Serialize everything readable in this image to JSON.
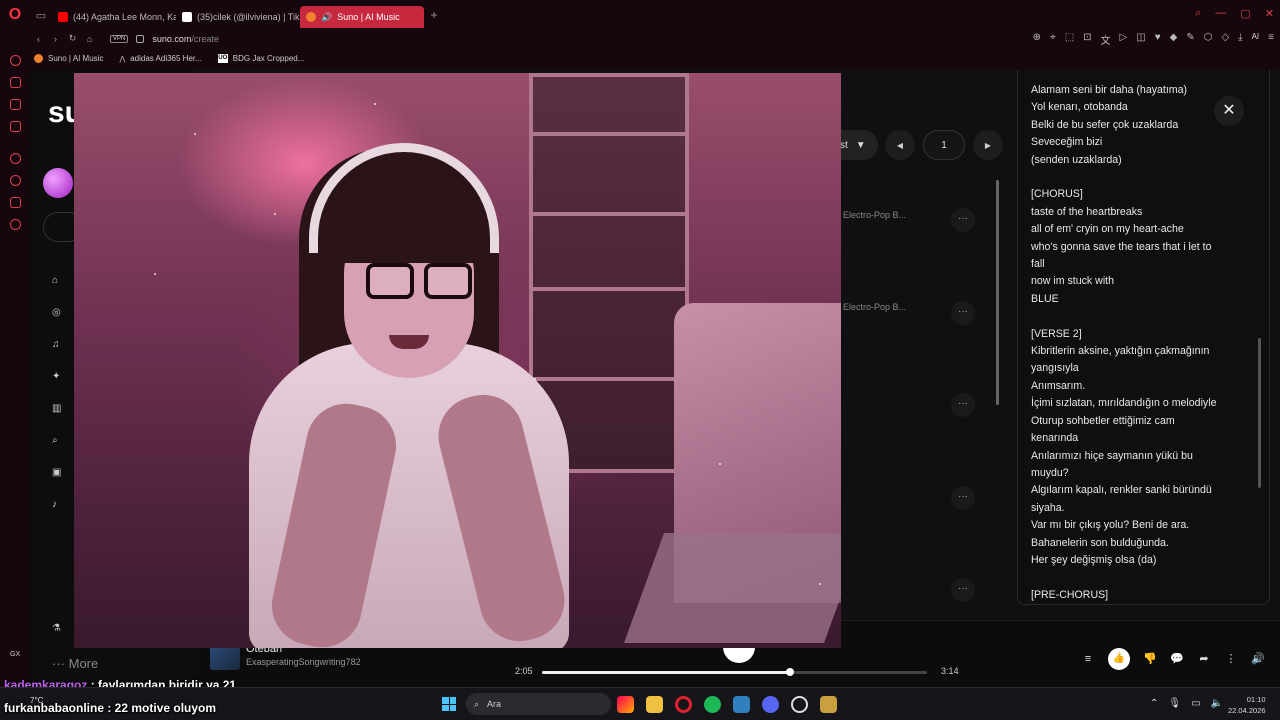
{
  "browser": {
    "tabs": [
      {
        "label": "(44) Agatha Lee Monn, Ka",
        "favicon_color": "#ff0000"
      },
      {
        "label": "(35)cilek (@ilviviena) | Tik",
        "favicon_color": "#ffffff"
      },
      {
        "label": "Suno | AI Music",
        "favicon_color": "#f08030",
        "active": true
      }
    ],
    "vpn_label": "VPN",
    "url_host": "suno.com",
    "url_path": "/create",
    "ai_label": "AI",
    "bookmarks": [
      {
        "label": "Suno | AI Music",
        "icon": "suno-icon"
      },
      {
        "label": "adidas Adi365 Her...",
        "icon": "adidas-icon"
      },
      {
        "label": "BDG Jax Cropped...",
        "icon": "uo-icon"
      }
    ],
    "uo_badge": "UO",
    "gx_label": "GX"
  },
  "suno": {
    "logo_text": "su",
    "sort_label": "st",
    "page_number": "1",
    "genre_1": "Electro-Pop B...",
    "genre_2": "Electro-Pop B...",
    "more_label": "More"
  },
  "lyrics": {
    "lines": [
      "Alamam seni bir daha (hayatıma)",
      "Yol kenarı, otobanda",
      "Belki de bu sefer çok uzaklarda",
      "Seveceğim bizi",
      "(senden uzaklarda)",
      "",
      "[CHORUS]",
      "taste of the heartbreaks",
      "all of em' cryin on my heart-ache",
      "who's gonna save the tears that i let to",
      "fall",
      "now im stuck with",
      "BLUE",
      "",
      "[VERSE 2]",
      "Kibritlerin aksine, yaktığın çakmağının",
      "yangısıyla",
      "Anımsarım.",
      "İçimi sızlatan, mırıldandığın o melodiyle",
      "Oturup sohbetler ettiğimiz cam",
      "kenarında",
      "Anılarımızı hiçe saymanın yükü bu",
      "muydu?",
      "Algılarım kapalı, renkler sanki büründü",
      "siyaha.",
      "Var mı bir çıkış yolu? Beni de ara.",
      "Bahanelerin son bulduğunda.",
      "Her şey değişmiş olsa (da)",
      "",
      "[PRE-CHORUS]"
    ]
  },
  "player": {
    "song_title": "Oteban",
    "artist": "ExasperatingSongwriting782",
    "current_time": "2:05",
    "total_time": "3:14",
    "progress_fraction": 0.644
  },
  "chat": [
    {
      "user": "kademkaragoz",
      "message": " : favlarımdan biridir ya 21"
    },
    {
      "user": "furkanbabaonline",
      "message": " : 22 motive oluyom"
    }
  ],
  "taskbar": {
    "weather": "7°C",
    "search_placeholder": "Ara",
    "time": "01:10",
    "date": "22.04.2026"
  }
}
